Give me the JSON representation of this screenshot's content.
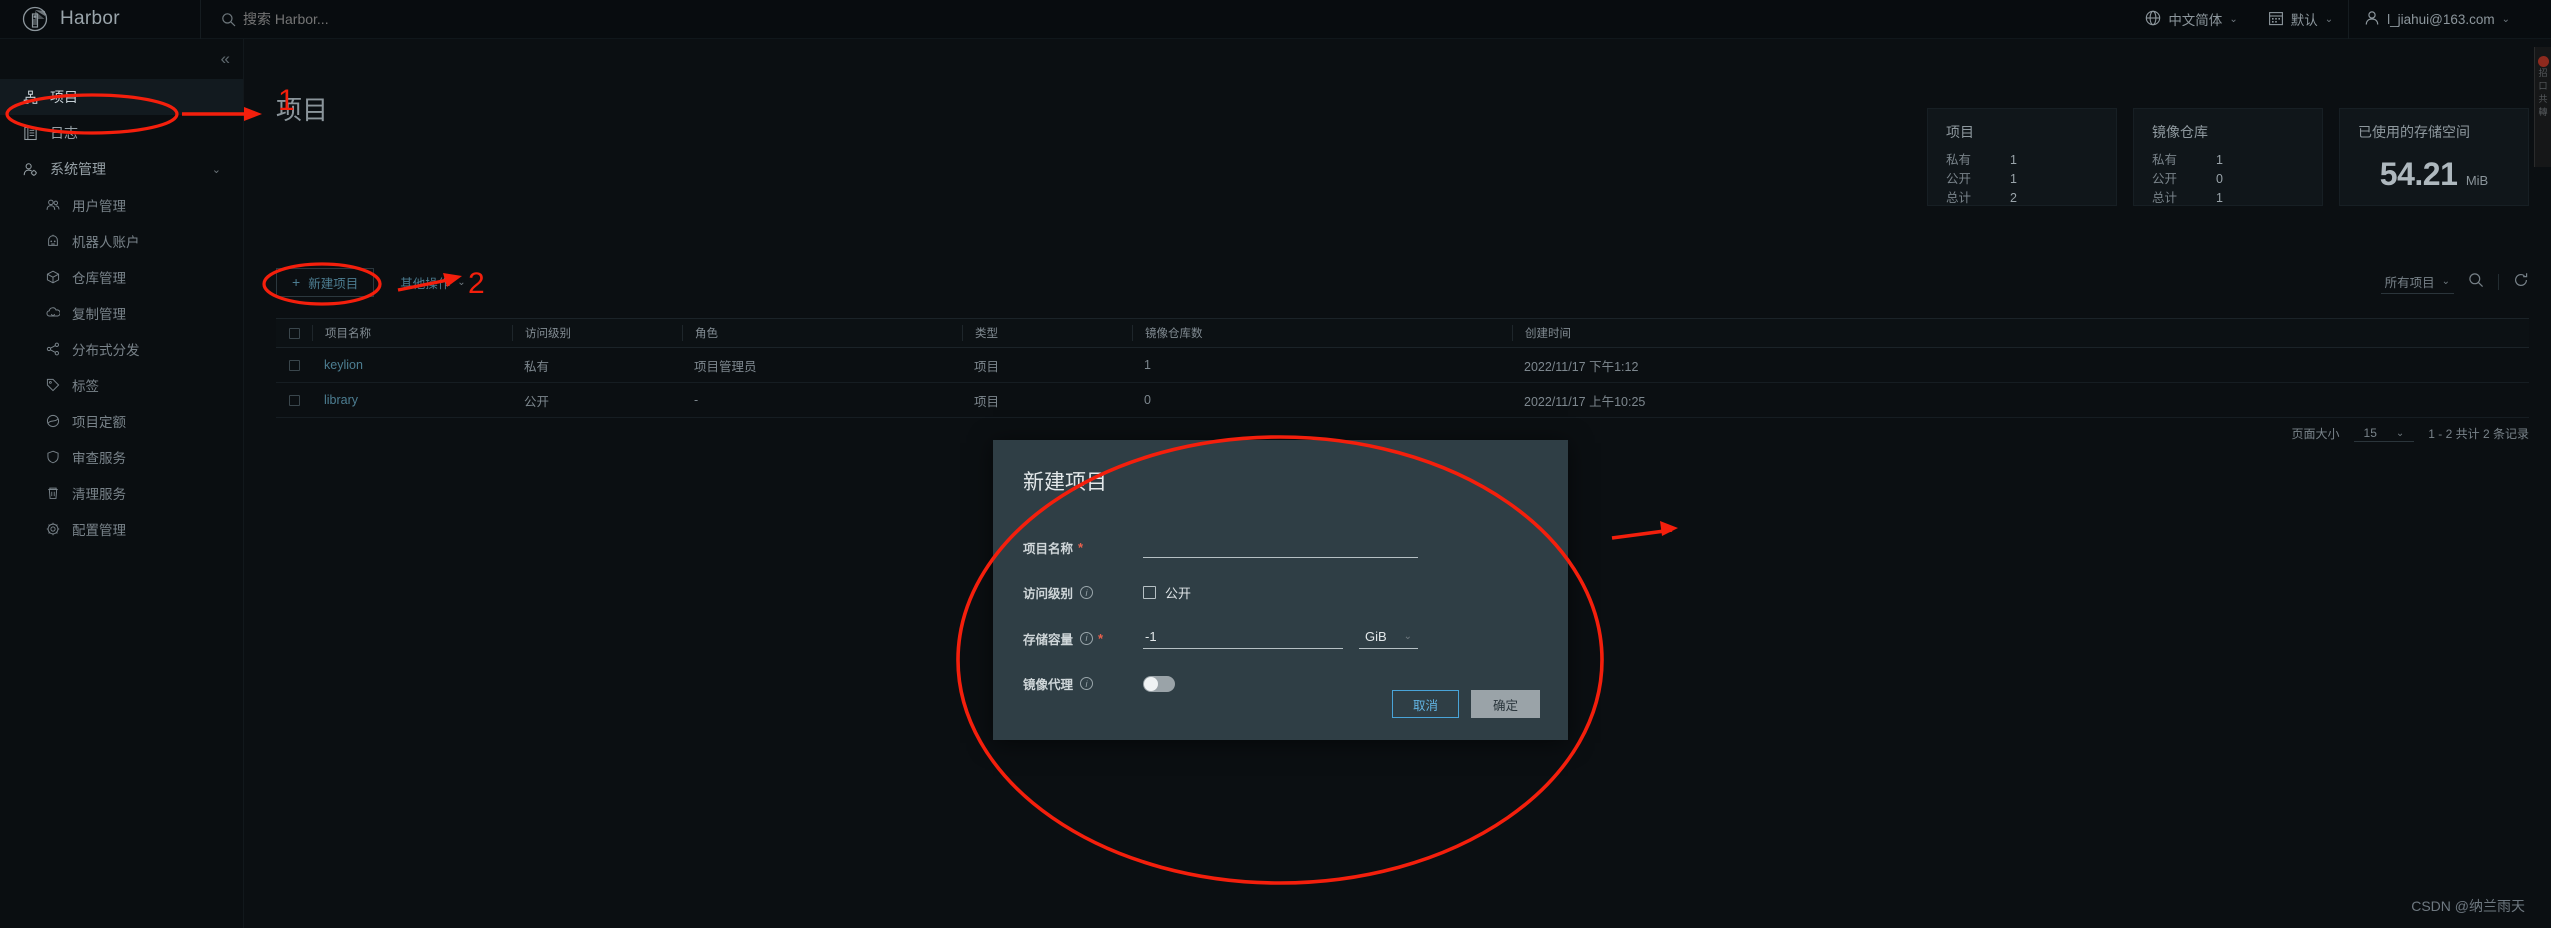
{
  "header": {
    "brand": "Harbor",
    "search_placeholder": "搜索 Harbor...",
    "language": "中文简体",
    "theme": "默认",
    "user": "l_jiahui@163.com"
  },
  "sidebar": {
    "collapse_label": "«",
    "items": [
      {
        "label": "项目",
        "icon": "projects-icon",
        "level": "top",
        "active": true
      },
      {
        "label": "日志",
        "icon": "logs-icon",
        "level": "top",
        "active": false
      },
      {
        "label": "系统管理",
        "icon": "administration-icon",
        "level": "top",
        "active": false,
        "expandable": true
      },
      {
        "label": "用户管理",
        "icon": "users-icon",
        "level": "sub",
        "active": false
      },
      {
        "label": "机器人账户",
        "icon": "robot-icon",
        "level": "sub",
        "active": false
      },
      {
        "label": "仓库管理",
        "icon": "registry-icon",
        "level": "sub",
        "active": false
      },
      {
        "label": "复制管理",
        "icon": "replication-icon",
        "level": "sub",
        "active": false
      },
      {
        "label": "分布式分发",
        "icon": "distribution-icon",
        "level": "sub",
        "active": false
      },
      {
        "label": "标签",
        "icon": "label-icon",
        "level": "sub",
        "active": false
      },
      {
        "label": "项目定额",
        "icon": "quota-icon",
        "level": "sub",
        "active": false
      },
      {
        "label": "审查服务",
        "icon": "scanner-icon",
        "level": "sub",
        "active": false
      },
      {
        "label": "清理服务",
        "icon": "gc-icon",
        "level": "sub",
        "active": false
      },
      {
        "label": "配置管理",
        "icon": "configuration-icon",
        "level": "sub",
        "active": false
      }
    ]
  },
  "page": {
    "title": "项目"
  },
  "stats": [
    {
      "title": "项目",
      "rows": [
        {
          "key": "私有",
          "value": "1"
        },
        {
          "key": "公开",
          "value": "1"
        },
        {
          "key": "总计",
          "value": "2"
        }
      ]
    },
    {
      "title": "镜像仓库",
      "rows": [
        {
          "key": "私有",
          "value": "1"
        },
        {
          "key": "公开",
          "value": "0"
        },
        {
          "key": "总计",
          "value": "1"
        }
      ]
    }
  ],
  "storage": {
    "title": "已使用的存储空间",
    "value": "54.21",
    "unit": "MiB"
  },
  "toolbar": {
    "new_project": "新建项目",
    "new_project_plus": "+",
    "other_actions": "其他操作",
    "filter": "所有项目",
    "search_icon": "search-icon",
    "refresh_icon": "refresh-icon"
  },
  "table": {
    "columns": [
      "项目名称",
      "访问级别",
      "角色",
      "类型",
      "镜像仓库数",
      "创建时间"
    ],
    "rows": [
      {
        "name": "keylion",
        "access": "私有",
        "role": "项目管理员",
        "type": "项目",
        "repos": "1",
        "created": "2022/11/17 下午1:12"
      },
      {
        "name": "library",
        "access": "公开",
        "role": "-",
        "type": "项目",
        "repos": "0",
        "created": "2022/11/17 上午10:25"
      }
    ]
  },
  "pagination": {
    "page_size_label": "页面大小",
    "page_size": "15",
    "range": "1 - 2 共计 2 条记录"
  },
  "modal": {
    "title": "新建项目",
    "name_label": "项目名称",
    "name_value": "",
    "access_label": "访问级别",
    "access_checkbox_label": "公开",
    "quota_label": "存储容量",
    "quota_value": "-1",
    "quota_unit": "GiB",
    "proxy_label": "镜像代理",
    "cancel": "取消",
    "confirm": "确定"
  },
  "annotations": {
    "num1": "1",
    "num2": "2"
  },
  "watermark": "CSDN @纳兰雨天",
  "colors": {
    "annotation_red": "#f41f0c",
    "link_blue": "#4d7e92",
    "modal_bg": "#2f3e45",
    "cancel_blue": "#62b3e2"
  }
}
